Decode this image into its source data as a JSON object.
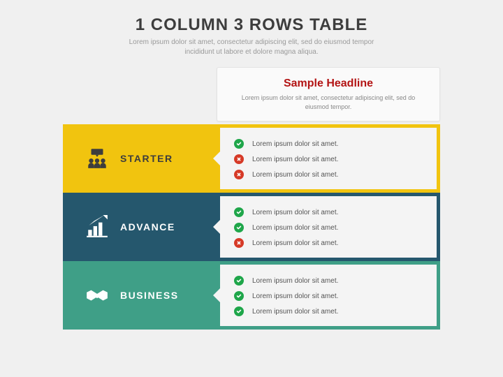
{
  "title": "1 COLUMN 3 ROWS TABLE",
  "subtitle": "Lorem ipsum dolor sit amet, consectetur adipiscing elit, sed do eiusmod tempor incididunt ut labore et dolore magna aliqua.",
  "header": {
    "headline": "Sample Headline",
    "text": "Lorem ipsum dolor sit amet, consectetur adipiscing elit, sed do eiusmod tempor."
  },
  "rows": {
    "starter": {
      "label": "STARTER",
      "feat0": "Lorem ipsum dolor sit amet.",
      "feat1": "Lorem ipsum dolor sit amet.",
      "feat2": "Lorem ipsum dolor sit amet."
    },
    "advance": {
      "label": "ADVANCE",
      "feat0": "Lorem ipsum dolor sit amet.",
      "feat1": "Lorem ipsum dolor sit amet.",
      "feat2": "Lorem ipsum dolor sit amet."
    },
    "business": {
      "label": "BUSINESS",
      "feat0": "Lorem ipsum dolor sit amet.",
      "feat1": "Lorem ipsum dolor sit amet.",
      "feat2": "Lorem ipsum dolor sit amet."
    }
  }
}
